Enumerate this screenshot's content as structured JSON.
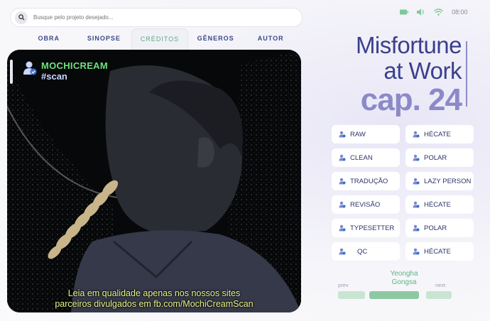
{
  "search": {
    "placeholder": "Busque pelo projeto desejado..."
  },
  "status_bar": {
    "time": "08:00"
  },
  "tabs": [
    {
      "label": "OBRA"
    },
    {
      "label": "SINOPSE"
    },
    {
      "label": "CRÉDITOS"
    },
    {
      "label": "GÊNEROS"
    },
    {
      "label": "AUTOR"
    }
  ],
  "active_tab": "CRÉDITOS",
  "panel": {
    "brand_name": "MOCHICREAM",
    "brand_tag": "#scan",
    "notice_line1": "Leia em qualidade apenas nos nossos sites",
    "notice_line2": "parceiros divulgados em fb.com/MochiCreamScan"
  },
  "title": {
    "line1": "Misfortune",
    "line2": "at Work",
    "chapter": "cap. 24"
  },
  "credits": [
    {
      "role": "RAW",
      "member": "HÉCATE"
    },
    {
      "role": "CLEAN",
      "member": "POLAR"
    },
    {
      "role": "TRADUÇÃO",
      "member": "LAZY PERSON"
    },
    {
      "role": "REVISÃO",
      "member": "HÉCATE"
    },
    {
      "role": "TYPESETTER",
      "member": "POLAR"
    },
    {
      "role": "QC",
      "member": "HÉCATE"
    }
  ],
  "nav": {
    "prev": "prev",
    "next": "next",
    "center_line1": "Yeongha",
    "center_line2": "Gongsa"
  },
  "colors": {
    "accent": "#3a3f8c",
    "chapter": "#8c89c9",
    "green": "#5aa888",
    "notice": "#e8f58a"
  }
}
